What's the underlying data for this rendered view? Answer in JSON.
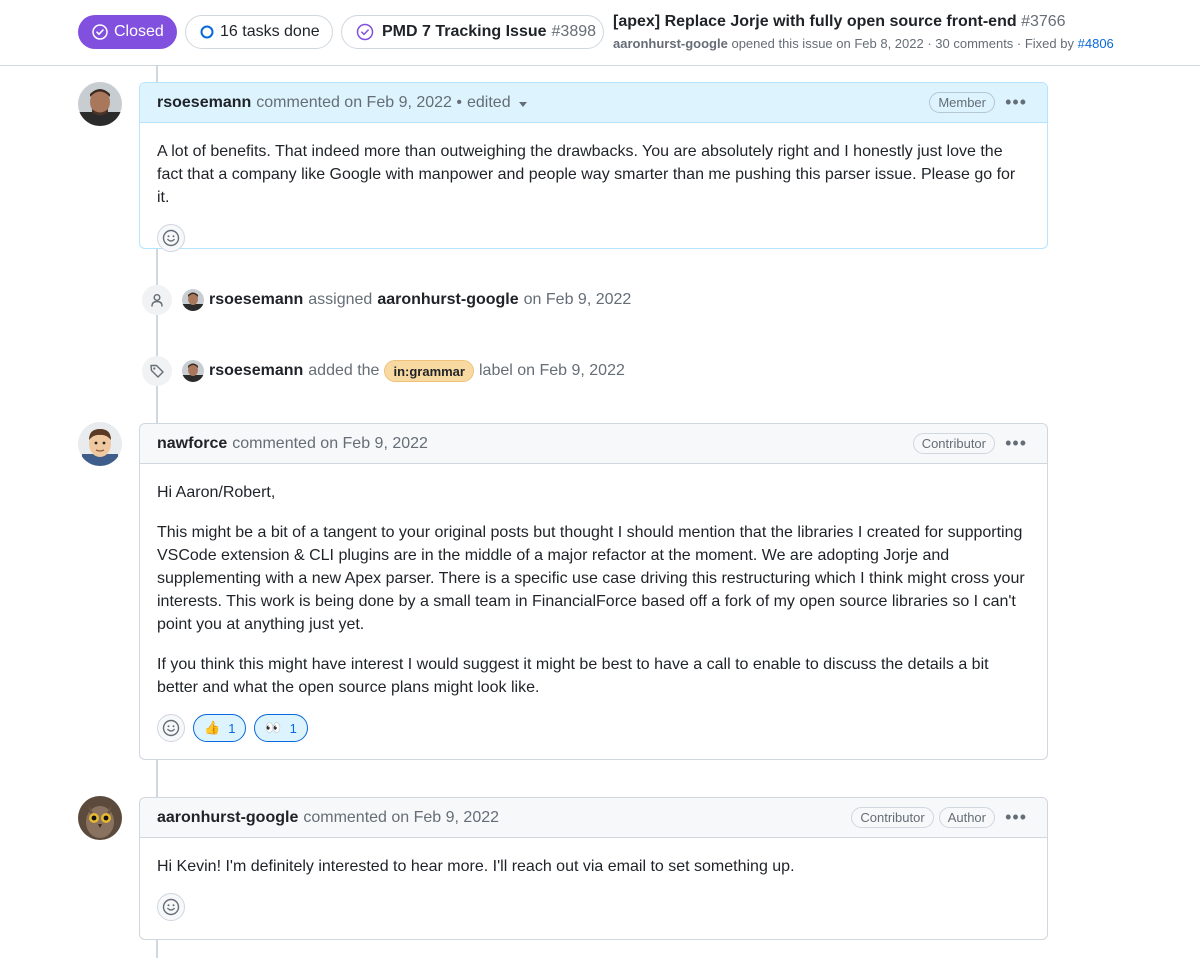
{
  "header": {
    "status_label": "Closed",
    "tasks_label": "16 tasks done",
    "tracking_title": "PMD 7 Tracking Issue",
    "tracking_number": "#3898",
    "issue_title": "[apex] Replace Jorje with fully open source front-end",
    "issue_number": "#3766",
    "opened_by": "aaronhurst-google",
    "opened_text": "opened this issue on Feb 8, 2022 · 30 comments · Fixed by",
    "fixed_by": "#4806"
  },
  "colors": {
    "closed": "#8250df",
    "link": "#0969da",
    "label_grammar": "#f9d9a2",
    "member_header": "#ddf4ff"
  },
  "comments": [
    {
      "author": "rsoesemann",
      "meta": "commented on Feb 9, 2022 •",
      "edited": "edited",
      "badges": [
        "Member"
      ],
      "paragraphs": [
        "A lot of benefits. That indeed more than outweighing the drawbacks. You are absolutely right and I honestly just love the fact that a company like Google with manpower and people way smarter than me pushing this parser issue. Please go for it."
      ],
      "reactions": []
    },
    {
      "author": "nawforce",
      "meta": "commented on Feb 9, 2022",
      "badges": [
        "Contributor"
      ],
      "paragraphs": [
        "Hi Aaron/Robert,",
        "This might be a bit of a tangent to your original posts but thought I should mention that the libraries I created for supporting VSCode extension & CLI plugins are in the middle of a major refactor at the moment. We are adopting Jorje and supplementing with a new Apex parser. There is a specific use case driving this restructuring which I think might cross your interests. This work is being done by a small team in FinancialForce based off a fork of my open source libraries so I can't point you at anything just yet.",
        "If you think this might have interest I would suggest it might be best to have a call to enable to discuss the details a bit better and what the open source plans might look like."
      ],
      "reactions": [
        {
          "emoji": "👍",
          "count": "1"
        },
        {
          "emoji": "👀",
          "count": "1"
        }
      ]
    },
    {
      "author": "aaronhurst-google",
      "meta": "commented on Feb 9, 2022",
      "badges": [
        "Contributor",
        "Author"
      ],
      "paragraphs": [
        "Hi Kevin! I'm definitely interested to hear more. I'll reach out via email to set something up."
      ],
      "reactions": []
    }
  ],
  "events": [
    {
      "actor": "rsoesemann",
      "action": "assigned",
      "target": "aaronhurst-google",
      "date": "on Feb 9, 2022",
      "icon": "person-icon"
    },
    {
      "actor": "rsoesemann",
      "action": "added the",
      "label": "in:grammar",
      "suffix": "label on Feb 9, 2022",
      "icon": "tag-icon"
    }
  ],
  "icons": {
    "kebab": "•••",
    "smiley": "smiley-icon"
  }
}
